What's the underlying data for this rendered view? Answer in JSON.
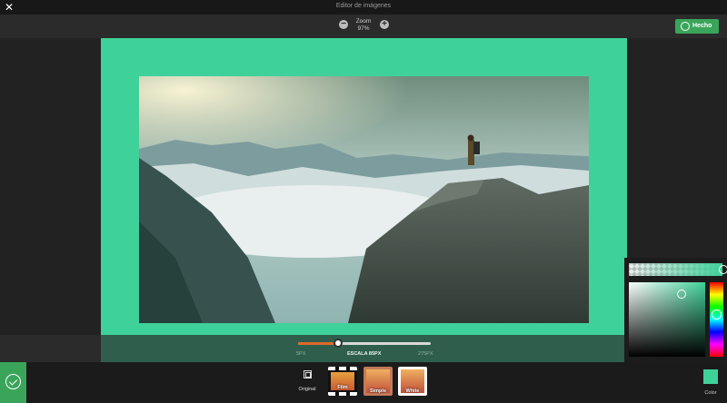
{
  "window": {
    "title": "Editor de imágenes",
    "close_icon": "close-icon"
  },
  "zoom": {
    "label": "Zoom",
    "value": "97%"
  },
  "toolbar": {
    "done_label": "Hecho"
  },
  "frame": {
    "color": "#3fd19a",
    "scale_bar_color": "#2f5f4c"
  },
  "scale": {
    "min": "5PX",
    "current": "ESCALA 85PX",
    "max": "275PX",
    "level": 0.3
  },
  "picker": {
    "selected_color": "#3fd19a"
  },
  "bottom": {
    "original_label": "Original",
    "thumbs": [
      {
        "label": "Film"
      },
      {
        "label": "Simple"
      },
      {
        "label": "White"
      }
    ],
    "color_label": "Color"
  }
}
